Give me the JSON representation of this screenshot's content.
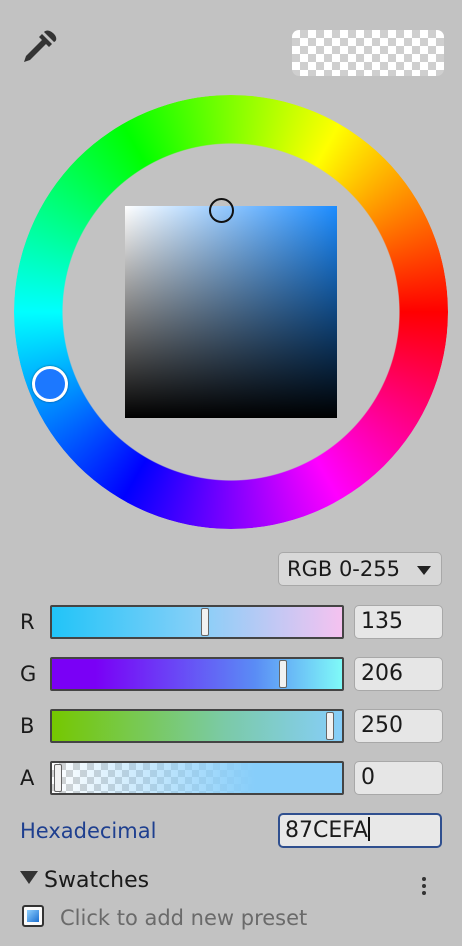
{
  "header": {
    "eyedropper_icon": "eyedropper-icon",
    "preview_color": "#87CEFA00"
  },
  "picker": {
    "current_color": "#87CEFA"
  },
  "mode": {
    "selected": "RGB 0-255"
  },
  "channels": [
    {
      "label": "R",
      "value": "135",
      "fraction": 0.53
    },
    {
      "label": "G",
      "value": "206",
      "fraction": 0.81
    },
    {
      "label": "B",
      "value": "250",
      "fraction": 0.98
    },
    {
      "label": "A",
      "value": "0",
      "fraction": 0.0
    }
  ],
  "hex": {
    "label": "Hexadecimal",
    "value": "87CEFA"
  },
  "swatches": {
    "title": "Swatches",
    "add_preset": "Click to add new preset"
  }
}
